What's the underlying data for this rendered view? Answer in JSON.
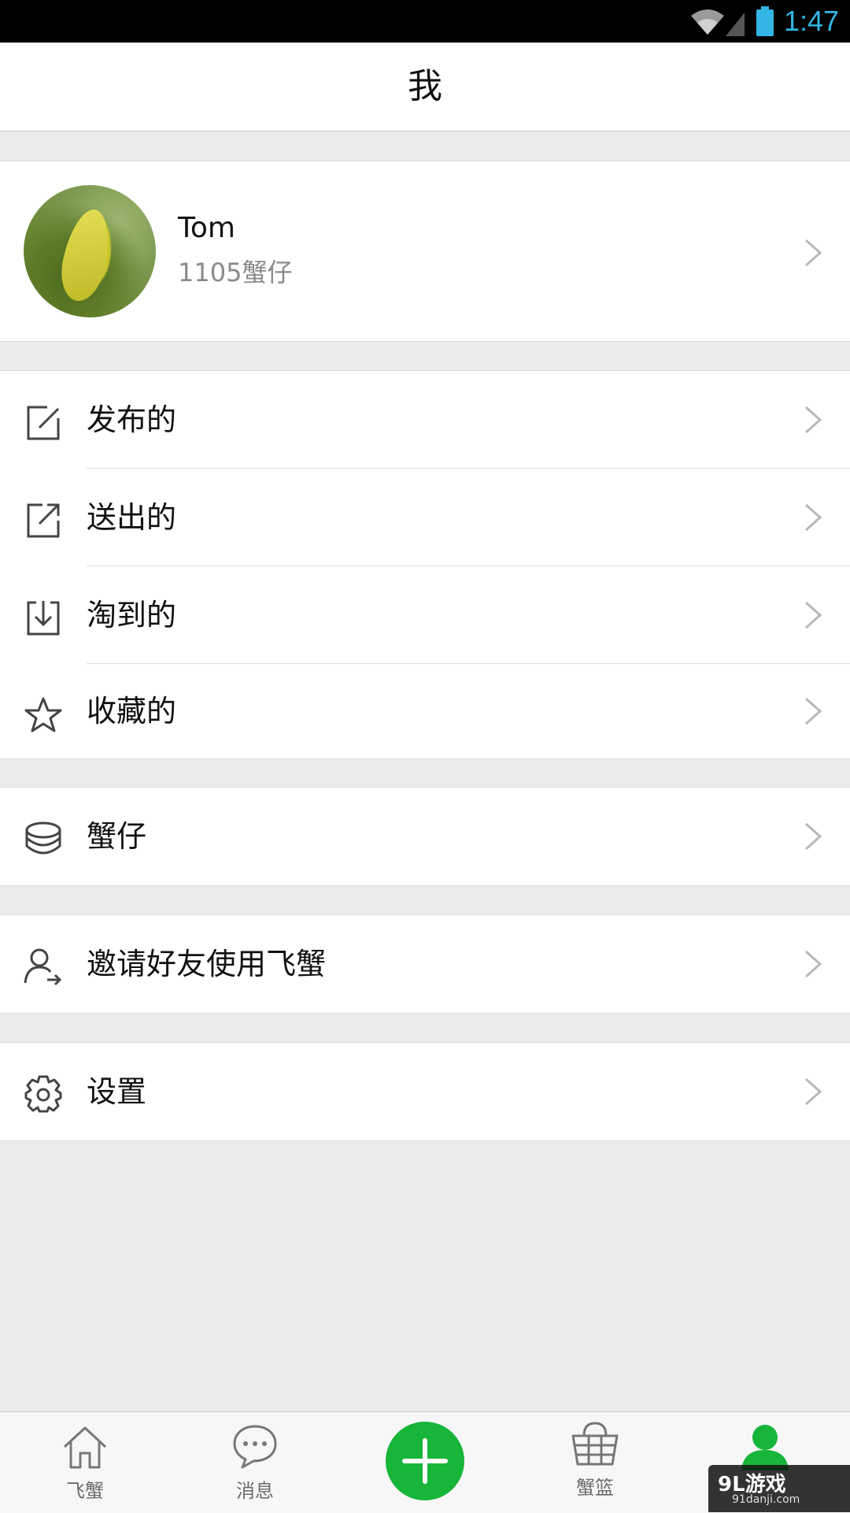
{
  "status_bar": {
    "time": "1:47"
  },
  "header": {
    "title": "我"
  },
  "profile": {
    "name": "Tom",
    "points": "1105蟹仔"
  },
  "menu": [
    {
      "label": "发布的",
      "icon": "edit-icon"
    },
    {
      "label": "送出的",
      "icon": "share-out-icon"
    },
    {
      "label": "淘到的",
      "icon": "download-icon"
    },
    {
      "label": "收藏的",
      "icon": "star-icon"
    },
    {
      "label": "蟹仔",
      "icon": "coins-icon"
    },
    {
      "label": "邀请好友使用飞蟹",
      "icon": "invite-user-icon"
    },
    {
      "label": "设置",
      "icon": "gear-icon"
    }
  ],
  "bottom_nav": [
    {
      "label": "飞蟹",
      "icon": "home-icon"
    },
    {
      "label": "消息",
      "icon": "message-icon"
    },
    {
      "label": "",
      "icon": "add-icon"
    },
    {
      "label": "蟹篮",
      "icon": "basket-icon"
    },
    {
      "label": "",
      "icon": "profile-icon"
    }
  ],
  "watermark": {
    "text": "9L游戏",
    "sub": "91danji.com"
  },
  "colors": {
    "accent_green": "#17b53a",
    "status_blue": "#33b5e5"
  }
}
